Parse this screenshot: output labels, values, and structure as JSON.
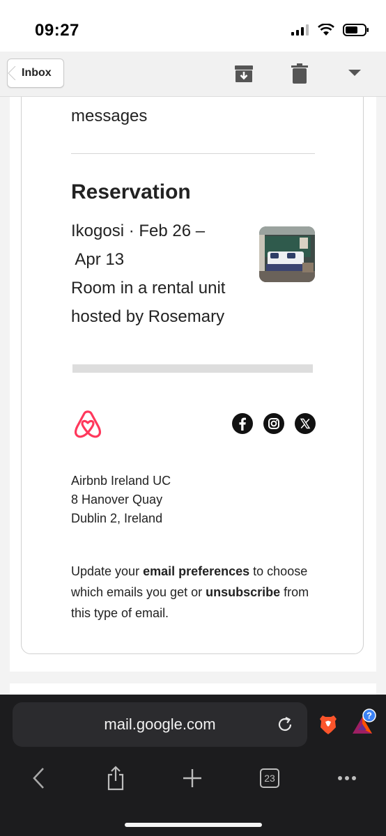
{
  "status_bar": {
    "time": "09:27"
  },
  "toolbar": {
    "back_label": "Inbox"
  },
  "email": {
    "cut_text": "messages",
    "reservation": {
      "heading": "Reservation",
      "line1": "Ikogosi · Feb 26 –",
      "line2": " Apr 13",
      "line3": "Room in a rental unit",
      "line4": "hosted by Rosemary"
    },
    "footer": {
      "address": [
        "Airbnb Ireland UC",
        "8 Hanover Quay",
        "Dublin 2, Ireland"
      ],
      "prefs_text_1": "Update your ",
      "prefs_link_1": "email preferences",
      "prefs_text_2": " to choose which emails you get or ",
      "prefs_link_2": "unsubscribe",
      "prefs_text_3": " from this type of email."
    },
    "social_icons": [
      "facebook-icon",
      "instagram-icon",
      "x-icon"
    ]
  },
  "browser": {
    "url": "mail.google.com",
    "tab_count": "23"
  },
  "colors": {
    "airbnb_brand": "#FF385C",
    "browser_bar": "#1c1c1e"
  }
}
